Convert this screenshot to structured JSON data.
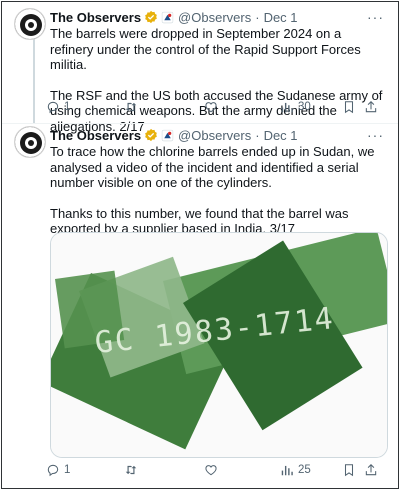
{
  "tweets": [
    {
      "author_name": "The Observers",
      "handle": "@Observers",
      "separator": "·",
      "date": "Dec 1",
      "paragraphs": [
        "The barrels were dropped in September 2024 on a refinery under the control of the Rapid Support Forces militia.",
        "The RSF and the US both accused the Sudanese army of using chemical weapons. But the army denied the allegations. 2/17"
      ],
      "actions": {
        "reply_count": "1",
        "retweet_count": "",
        "like_count": "",
        "views_count": "30"
      }
    },
    {
      "author_name": "The Observers",
      "handle": "@Observers",
      "separator": "·",
      "date": "Dec 1",
      "paragraphs": [
        "To trace how the chlorine barrels ended up in Sudan, we analysed a video of the incident and identified a serial number visible on one of the cylinders.",
        "Thanks to this number, we found that the barrel was exported by a supplier based in India. 3/17"
      ],
      "media": {
        "serial_text": "GC 1983-1714"
      },
      "actions": {
        "reply_count": "1",
        "retweet_count": "",
        "like_count": "",
        "views_count": "25"
      }
    }
  ],
  "icons": {
    "more": "more-icon",
    "verified": "verified-badge-icon",
    "affiliate": "affiliate-badge-icon",
    "reply": "reply-icon",
    "retweet": "retweet-icon",
    "like": "heart-icon",
    "views": "views-icon",
    "bookmark": "bookmark-icon",
    "share": "share-icon"
  },
  "colors": {
    "text": "#0f1419",
    "secondary": "#536471",
    "verified_gold": "#e8b10b",
    "border": "#cfd9de",
    "barrel_green": "#4a8a4a"
  }
}
